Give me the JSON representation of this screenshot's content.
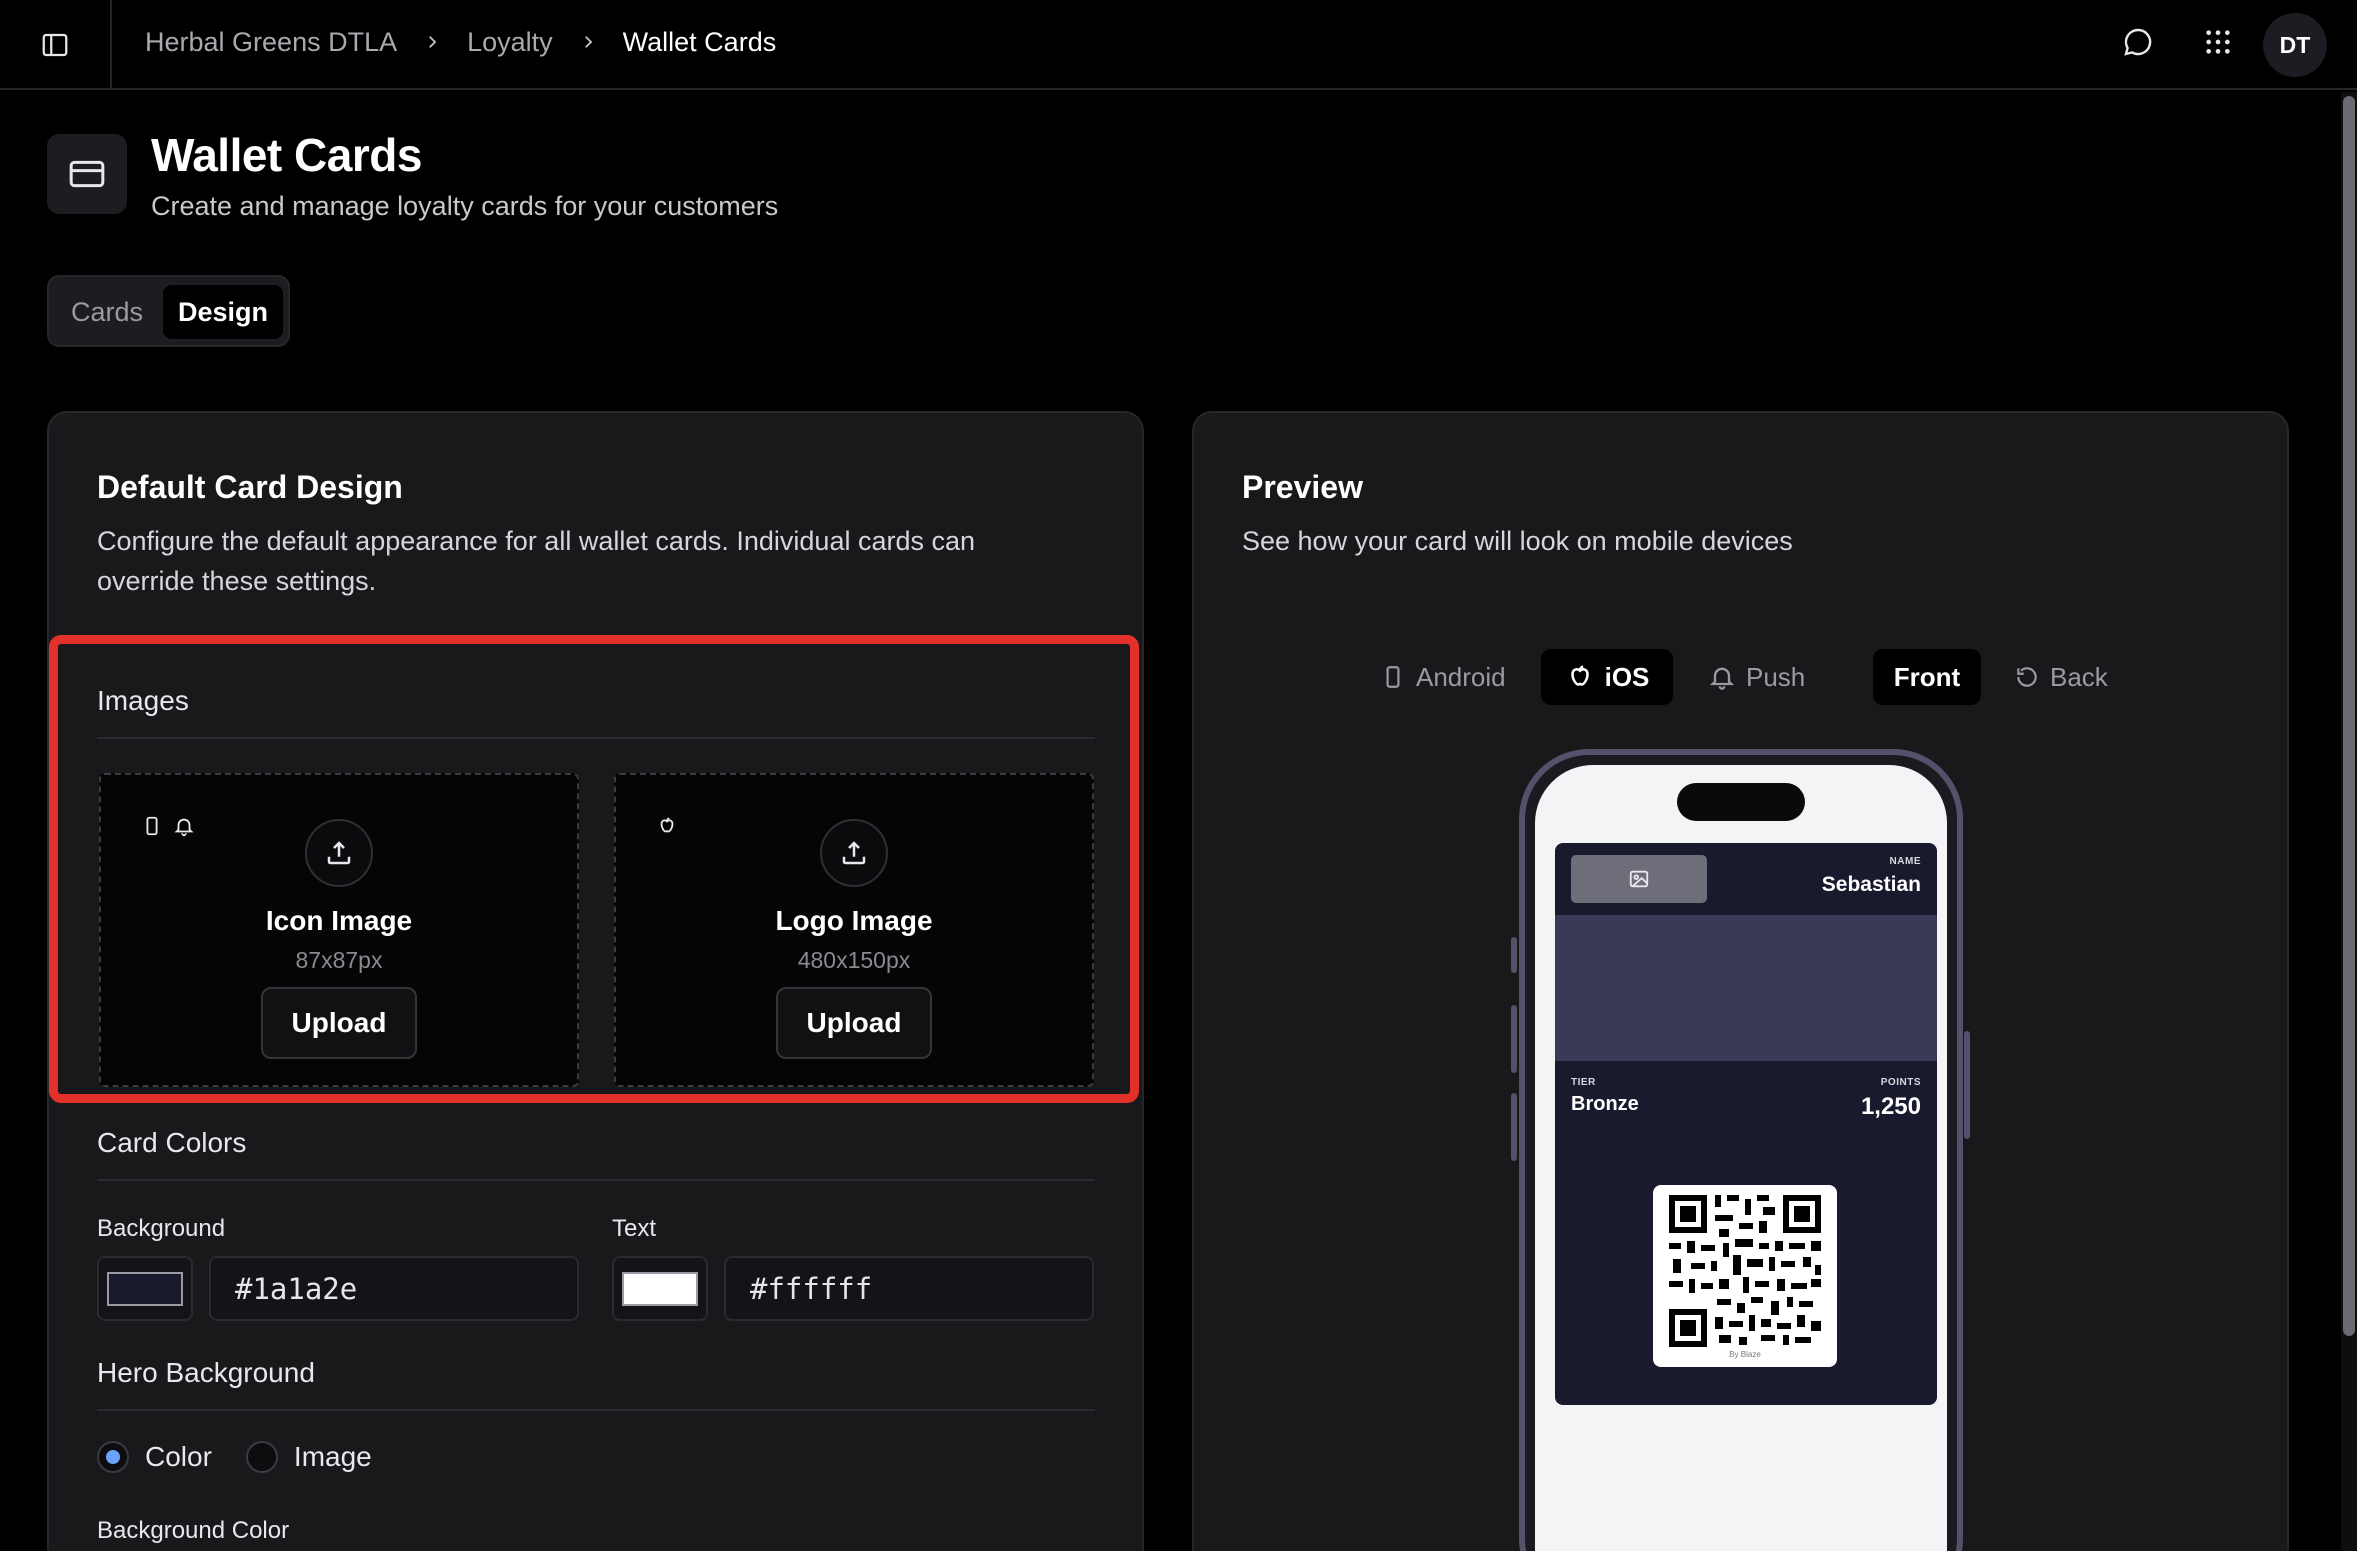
{
  "topbar": {
    "breadcrumbs": [
      "Herbal Greens DTLA",
      "Loyalty",
      "Wallet Cards"
    ],
    "avatar_initials": "DT"
  },
  "header": {
    "title": "Wallet Cards",
    "subtitle": "Create and manage loyalty cards for your customers"
  },
  "tabs": [
    {
      "label": "Cards",
      "active": false
    },
    {
      "label": "Design",
      "active": true
    }
  ],
  "design_panel": {
    "title": "Default Card Design",
    "description": "Configure the default appearance for all wallet cards. Individual cards can override these settings.",
    "images": {
      "section_label": "Images",
      "icon": {
        "title": "Icon Image",
        "size": "87x87px",
        "button": "Upload"
      },
      "logo": {
        "title": "Logo Image",
        "size": "480x150px",
        "button": "Upload"
      }
    },
    "card_colors": {
      "section_label": "Card Colors",
      "background": {
        "label": "Background",
        "value": "#1a1a2e"
      },
      "text": {
        "label": "Text",
        "value": "#ffffff"
      }
    },
    "hero": {
      "section_label": "Hero Background",
      "options": [
        {
          "label": "Color",
          "checked": true
        },
        {
          "label": "Image",
          "checked": false
        }
      ],
      "bg_color_label": "Background Color"
    }
  },
  "preview_panel": {
    "title": "Preview",
    "description": "See how your card will look on mobile devices",
    "platforms": [
      {
        "label": "Android",
        "active": false
      },
      {
        "label": "iOS",
        "active": true
      },
      {
        "label": "Push",
        "active": false
      }
    ],
    "sides": [
      {
        "label": "Front",
        "active": true
      },
      {
        "label": "Back",
        "active": false
      }
    ],
    "pass": {
      "name_label": "NAME",
      "name": "Sebastian",
      "tier_label": "TIER",
      "tier": "Bronze",
      "points_label": "POINTS",
      "points": "1,250",
      "qr_caption": "By Blaze",
      "hero_color": "#3b3a56"
    }
  },
  "colors": {
    "accent_highlight": "#e2302b",
    "radio_checked": "#6aa3ff"
  }
}
